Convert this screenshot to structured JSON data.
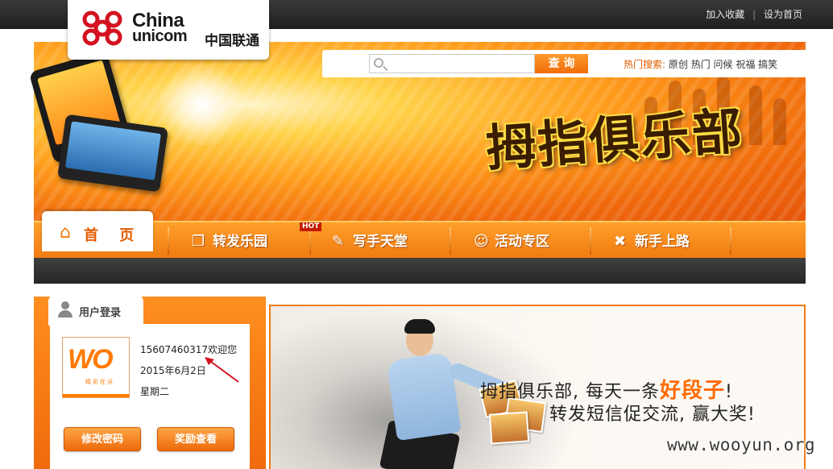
{
  "top_links": {
    "favorite": "加入收藏",
    "separator": "|",
    "homepage": "设为首页"
  },
  "logo": {
    "line1": "China",
    "line2": "unicom",
    "cn_name": "中国联通"
  },
  "search": {
    "placeholder": "",
    "button": "查 询",
    "hot_label": "热门搜索:",
    "hot_keywords": "原创 热门 问候 祝福 搞笑"
  },
  "banner": {
    "title": "拇指俱乐部"
  },
  "nav": {
    "home": "首 页",
    "hot_tag": "HOT",
    "items": [
      {
        "label": "转发乐园",
        "icon": "copy-icon"
      },
      {
        "label": "写手天堂",
        "icon": "pencil-icon"
      },
      {
        "label": "活动专区",
        "icon": "smiley-icon"
      },
      {
        "label": "新手上路",
        "icon": "tools-icon"
      }
    ]
  },
  "login": {
    "tab": "用户登录",
    "wo_logo": "WO",
    "wo_sub": "精彩在沃",
    "phone": "15607460317",
    "welcome": "欢迎您",
    "date": "2015年6月2日",
    "weekday": "星期二",
    "btn_password": "修改密码",
    "btn_rewards": "奖励查看"
  },
  "promo": {
    "line1_pre": "拇指俱乐部, 每天一条",
    "line1_highlight": "好段子",
    "line1_post": "!",
    "line2": "转发短信促交流, 赢大奖!"
  },
  "watermark": "www.wooyun.org",
  "colors": {
    "accent": "#f07a10",
    "dark": "#262626",
    "highlight": "#ff6a00"
  }
}
